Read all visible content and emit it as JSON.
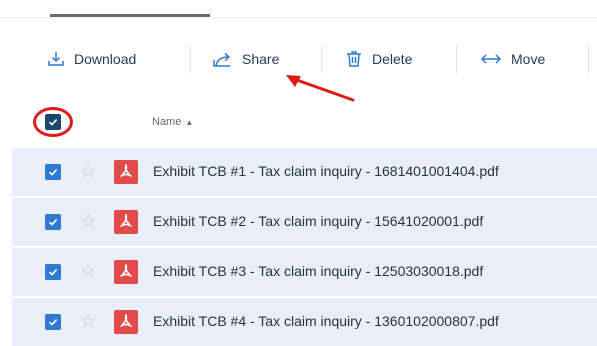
{
  "toolbar": {
    "download_label": "Download",
    "share_label": "Share",
    "delete_label": "Delete",
    "move_label": "Move"
  },
  "table": {
    "name_header": "Name",
    "sort_indicator": "▲",
    "rows": [
      {
        "name": "Exhibit TCB #1 - Tax claim inquiry - 1681401001404.pdf",
        "checked": true,
        "icon": "pdf-icon"
      },
      {
        "name": "Exhibit TCB #2 - Tax claim inquiry - 15641020001.pdf",
        "checked": true,
        "icon": "pdf-icon"
      },
      {
        "name": "Exhibit TCB #3 - Tax claim inquiry - 12503030018.pdf",
        "checked": true,
        "icon": "pdf-icon"
      },
      {
        "name": "Exhibit TCB #4 - Tax claim inquiry - 1360102000807.pdf",
        "checked": true,
        "icon": "pdf-icon"
      }
    ]
  },
  "colors": {
    "accent": "#2f7ad1",
    "selected_row": "#e9eff8",
    "pdf": "#e14b4b",
    "annotation": "#e01919"
  },
  "icons": [
    "download-icon",
    "share-icon",
    "trash-icon",
    "move-icon",
    "star-icon",
    "pdf-icon",
    "checkmark-icon"
  ]
}
